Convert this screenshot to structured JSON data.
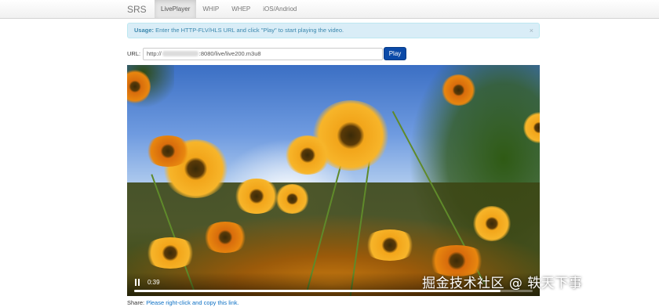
{
  "navbar": {
    "brand": "SRS",
    "items": [
      {
        "label": "LivePlayer",
        "active": true
      },
      {
        "label": "WHIP",
        "active": false
      },
      {
        "label": "WHEP",
        "active": false
      },
      {
        "label": "iOS/Andriod",
        "active": false
      }
    ]
  },
  "alert": {
    "strong": "Usage:",
    "text": " Enter the HTTP-FLV/HLS URL and click \"Play\" to start playing the video.",
    "close": "×"
  },
  "url_form": {
    "label": "URL:",
    "value_prefix": "http://",
    "value_suffix": ":8080/live/live200.m3u8",
    "play_label": "Play"
  },
  "video": {
    "time": "0:39",
    "progress": 0.92
  },
  "watermark": "掘金技术社区 @ 轶天下事",
  "share": {
    "label": "Share:",
    "link_text": "Please right-click and copy this link."
  }
}
